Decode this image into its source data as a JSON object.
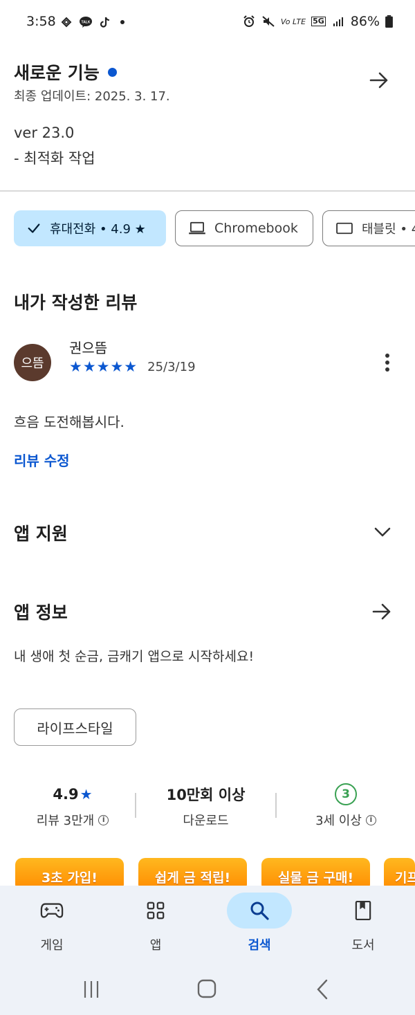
{
  "status_bar": {
    "time": "3:58",
    "battery": "86%",
    "network": "5G"
  },
  "whats_new": {
    "title": "새로운 기능",
    "updated": "최종 업데이트: 2025. 3. 17.",
    "version": "ver 23.0",
    "notes": "- 최적화 작업"
  },
  "device_chips": [
    {
      "label": "휴대전화 • 4.9 ★",
      "selected": true
    },
    {
      "label": "Chromebook",
      "selected": false
    },
    {
      "label": "태블릿 • 4",
      "selected": false
    }
  ],
  "my_review": {
    "heading": "내가 작성한 리뷰",
    "avatar_text": "으뜸",
    "author": "권으뜸",
    "rating": 5,
    "stars": "★★★★★",
    "date": "25/3/19",
    "text": "흐음 도전해봅시다.",
    "edit_link": "리뷰 수정"
  },
  "app_support": {
    "heading": "앱 지원"
  },
  "app_info": {
    "heading": "앱 정보",
    "description": "내 생애 첫 순금, 금캐기 앱으로 시작하세요!",
    "category_tag": "라이프스타일"
  },
  "stats": {
    "rating_value": "4.9",
    "rating_star": "★",
    "rating_label": "리뷰 3만개",
    "downloads_value": "10만회 이상",
    "downloads_label": "다운로드",
    "age_value": "3",
    "age_label": "3세 이상"
  },
  "promo_banners": [
    "3초 가입!",
    "쉽게 금 적립!",
    "실물 금 구매!",
    "기프"
  ],
  "bottom_nav": [
    {
      "label": "게임",
      "icon": "gamepad-icon",
      "active": false
    },
    {
      "label": "앱",
      "icon": "apps-grid-icon",
      "active": false
    },
    {
      "label": "검색",
      "icon": "search-icon",
      "active": true
    },
    {
      "label": "도서",
      "icon": "book-icon",
      "active": false
    }
  ],
  "colors": {
    "accent": "#0b57d0",
    "chip_selected_bg": "#c2e7ff",
    "nav_bg": "#eef2f8",
    "avatar_bg": "#5b3a2d",
    "age_green": "#3aa153",
    "promo_orange": "#ff8a00"
  }
}
